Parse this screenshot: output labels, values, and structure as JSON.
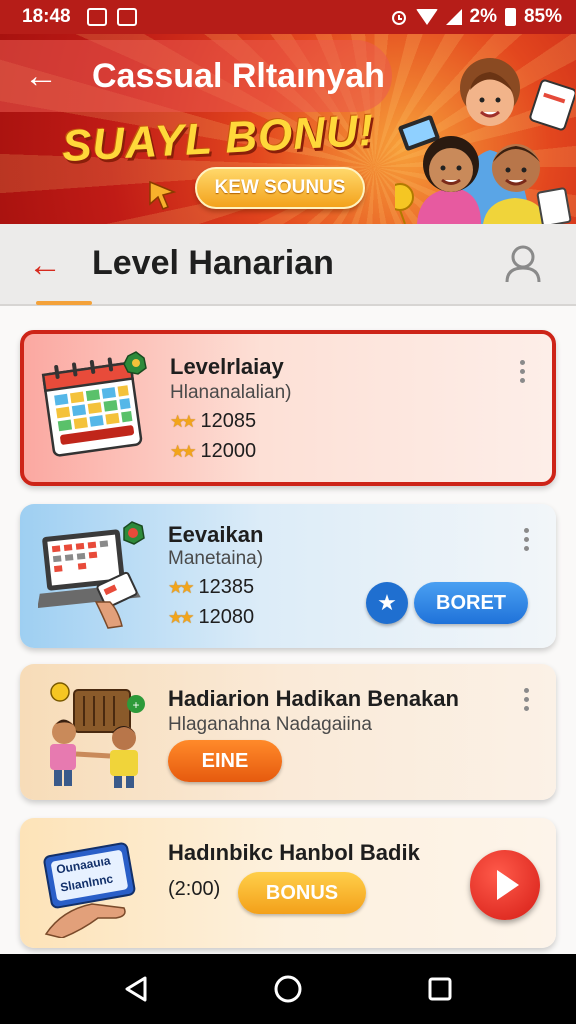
{
  "status_bar": {
    "time": "18:48",
    "icons_left": [
      "photo-icon",
      "mail-icon"
    ],
    "icons_right": [
      "alarm-icon",
      "wifi-icon",
      "signal-icon"
    ],
    "network_label": "2%",
    "battery_percent": "85%"
  },
  "banner": {
    "back_label": "←",
    "title": "Cassual Rltaınyah",
    "promo_text": "SUAYL BONU!",
    "promo_button_label": "KEW SOUNUS"
  },
  "app_bar": {
    "back_label": "←",
    "title": "Level Hanarian",
    "profile_icon": "person-icon"
  },
  "cards": [
    {
      "title": "Levelrlaiay",
      "subtitle": "Hlananalalian)",
      "score_1": "12085",
      "score_2": "12000",
      "icon": "calendar-icon"
    },
    {
      "title": "Eevaikan",
      "subtitle": "Manetaina)",
      "score_1": "12385",
      "score_2": "12080",
      "action_label": "BORET",
      "icon": "laptop-icon"
    },
    {
      "title": "Hadiarion Hadikan Benakan",
      "subtitle": "Hlaganahna Nadagaiina",
      "action_label": "EINE",
      "icon": "people-trade-icon"
    },
    {
      "title": "Hadınbikc Hanbol Badik",
      "time_label": "(2:00)",
      "action_label": "BONUS",
      "card_text_1": "Ounaauıa",
      "card_text_2": "Slıanlnnc",
      "icon": "ticket-icon"
    }
  ],
  "nav_bar": {
    "back_icon": "back-triangle-icon",
    "home_icon": "home-circle-icon",
    "recents_icon": "recents-square-icon"
  },
  "colors": {
    "accent_red": "#cd2418",
    "banner_yellow": "#ffd83a",
    "action_blue": "#1f72d9",
    "action_orange": "#e65a0e",
    "action_yellow": "#f3a01a"
  }
}
